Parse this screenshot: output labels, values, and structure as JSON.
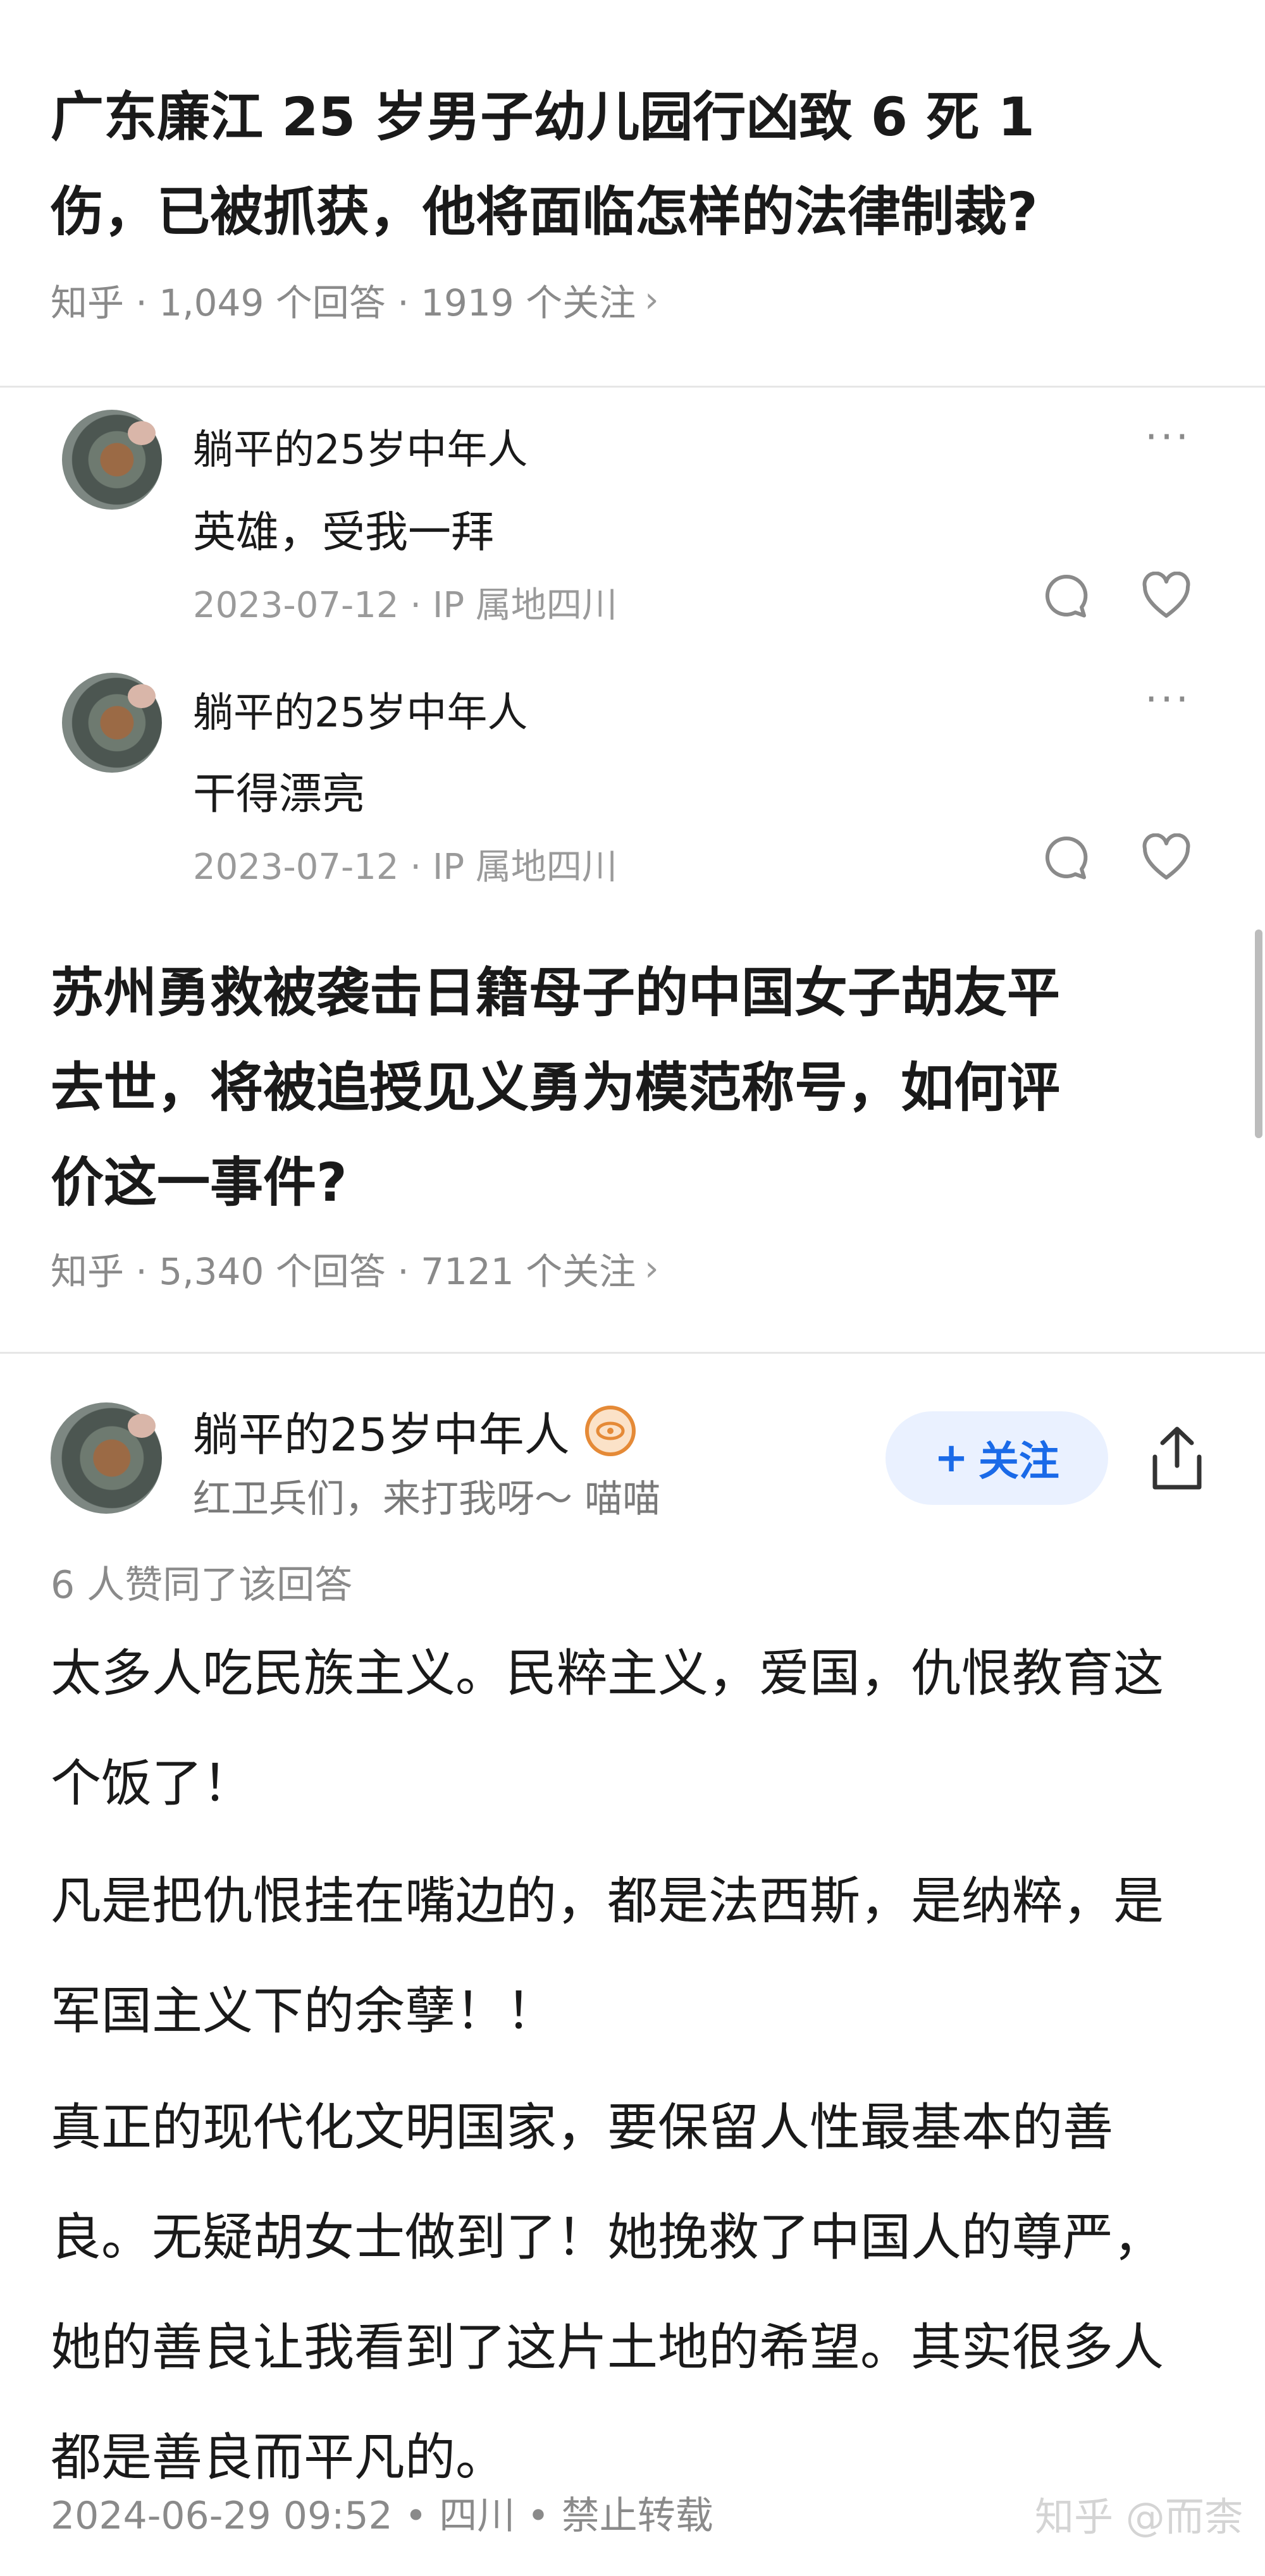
{
  "question1": {
    "title_line1": "广东廉江 25 岁男子幼儿园行凶致 6 死 1",
    "title_line2": "伤，已被抓获，他将面临怎样的法律制裁?",
    "meta": "知乎 · 1,049 个回答 · 1919 个关注",
    "chevron": "›"
  },
  "comments": [
    {
      "author": "躺平的25岁中年人",
      "text": "英雄，受我一拜",
      "meta": "2023-07-12 · IP 属地四川",
      "more": "···"
    },
    {
      "author": "躺平的25岁中年人",
      "text": "干得漂亮",
      "meta": "2023-07-12 · IP 属地四川",
      "more": "···"
    }
  ],
  "question2": {
    "title_line1": "苏州勇救被袭击日籍母子的中国女子胡友平",
    "title_line2": "去世，将被追授见义勇为模范称号，如何评",
    "title_line3": "价这一事件?",
    "meta": "知乎 · 5,340 个回答 · 7121 个关注",
    "chevron": "›"
  },
  "answer": {
    "author": "躺平的25岁中年人",
    "bio": "红卫兵们，来打我呀～ 喵喵",
    "follow_plus": "+",
    "follow_label": "关注",
    "votes": "6 人赞同了该回答",
    "paragraphs": [
      {
        "line1": "太多人吃民族主义。民粹主义，爱国，仇恨教育这",
        "line2": "个饭了！"
      },
      {
        "line1": "凡是把仇恨挂在嘴边的，都是法西斯，是纳粹，是",
        "line2": "军国主义下的余孽！！"
      },
      {
        "line1": "真正的现代化文明国家，要保留人性最基本的善",
        "line2": "良。无疑胡女士做到了！她挽救了中国人的尊严，",
        "line3": "她的善良让我看到了这片土地的希望。其实很多人",
        "line4": "都是善良而平凡的。"
      }
    ],
    "footer": "2024-06-29 09:52 • 四川 • 禁止转载"
  },
  "watermark": "知乎 @而柰",
  "icons": [
    "avatar",
    "more-icon",
    "comment-icon",
    "like-icon",
    "creator-badge-icon",
    "share-icon"
  ],
  "colors": {
    "follow_bg": "#eaf1ff",
    "follow_text": "#1a6ae8",
    "meta": "#8a8a8a",
    "badge": "#e58a37"
  }
}
